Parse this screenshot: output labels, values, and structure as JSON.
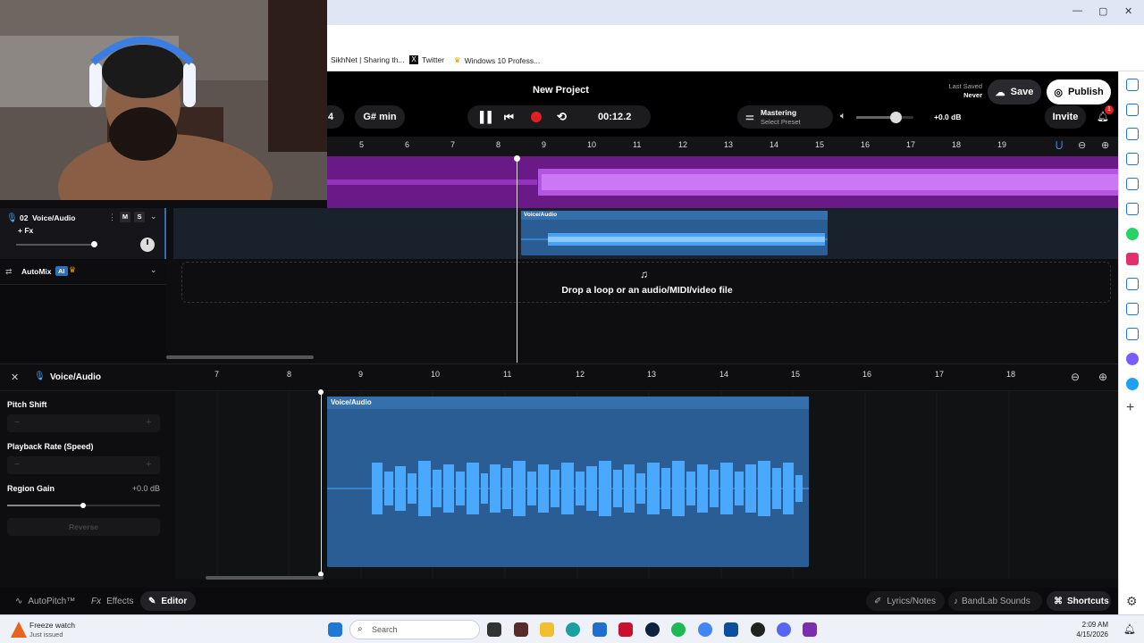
{
  "browser": {
    "bookmarks": [
      "SikhNet | Sharing th...",
      "Twitter",
      "Windows 10 Profess..."
    ],
    "window_controls": [
      "—",
      "▢",
      "✕"
    ]
  },
  "header": {
    "project_title": "New Project",
    "last_saved_label": "Last Saved",
    "last_saved_value": "Never",
    "save_label": "Save",
    "publish_label": "Publish",
    "tempo_partial": "4",
    "key": "G# min",
    "time": "00:12.2",
    "mastering_label": "Mastering",
    "mastering_preset": "Select Preset",
    "master_gain": "+0.0 dB",
    "invite_label": "Invite",
    "notification_count": "1"
  },
  "ruler_top": [
    "5",
    "6",
    "7",
    "8",
    "9",
    "10",
    "11",
    "12",
    "13",
    "14",
    "15",
    "16",
    "17",
    "18",
    "19"
  ],
  "tracks": {
    "track2_number": "02",
    "track2_name": "Voice/Audio",
    "track2_fx": "+ Fx",
    "mute": "M",
    "solo": "S",
    "region_label": "Voice/Audio",
    "automix_label": "AutoMix",
    "ai_badge": "AI",
    "drop_text": "Drop a loop or an audio/MIDI/video file"
  },
  "editor": {
    "title": "Voice/Audio",
    "ruler": [
      "7",
      "8",
      "9",
      "10",
      "11",
      "12",
      "13",
      "14",
      "15",
      "16",
      "17",
      "18"
    ],
    "pitch_shift_label": "Pitch Shift",
    "playback_rate_label": "Playback Rate (Speed)",
    "region_gain_label": "Region Gain",
    "region_gain_value": "+0.0 dB",
    "reverse_label": "Reverse",
    "region_label": "Voice/Audio",
    "stepper_minus": "−",
    "stepper_plus": "+"
  },
  "bottom": {
    "autopitch": "AutoPitch™",
    "effects": "Effects",
    "editor": "Editor",
    "lyrics": "Lyrics/Notes",
    "sounds": "BandLab Sounds",
    "shortcuts": "Shortcuts"
  },
  "taskbar": {
    "weather_title": "Freeze watch",
    "weather_sub": "Just issued",
    "search_placeholder": "Search",
    "time": "2:09 AM",
    "date": "4/15/2026"
  },
  "colors": {
    "accent": "#e02020",
    "region_blue": "#2f6fb5",
    "wave_blue": "#4aa8ff",
    "track_purple": "#8a1fb0"
  }
}
